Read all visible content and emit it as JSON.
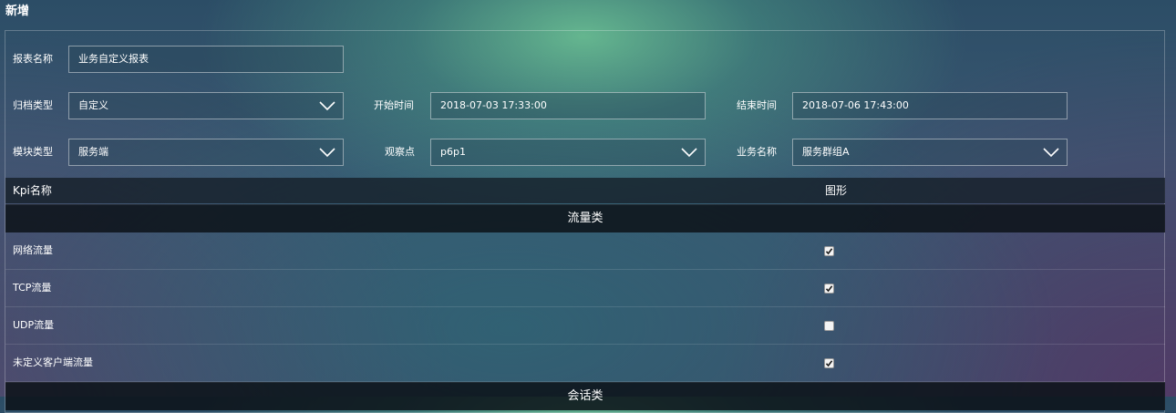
{
  "page": {
    "title": "新增"
  },
  "form": {
    "report_name": {
      "label": "报表名称",
      "value": "业务自定义报表"
    },
    "archive_type": {
      "label": "归档类型",
      "value": "自定义"
    },
    "start_time": {
      "label": "开始时间",
      "value": "2018-07-03 17:33:00"
    },
    "end_time": {
      "label": "结束时间",
      "value": "2018-07-06 17:43:00"
    },
    "module_type": {
      "label": "模块类型",
      "value": "服务端"
    },
    "observe_point": {
      "label": "观察点",
      "value": "p6p1"
    },
    "business_name": {
      "label": "业务名称",
      "value": "服务群组A"
    }
  },
  "table": {
    "headers": {
      "kpi": "Kpi名称",
      "graph": "图形"
    },
    "groups": [
      {
        "name": "流量类",
        "rows": [
          {
            "name": "网络流量",
            "checked": true
          },
          {
            "name": "TCP流量",
            "checked": true
          },
          {
            "name": "UDP流量",
            "checked": false
          },
          {
            "name": "未定义客户端流量",
            "checked": true
          }
        ]
      },
      {
        "name": "会话类",
        "rows": []
      }
    ]
  },
  "colors": {
    "border": "#a6b4bf",
    "header_bg": "#141e26",
    "group_bg": "#0c1218"
  }
}
